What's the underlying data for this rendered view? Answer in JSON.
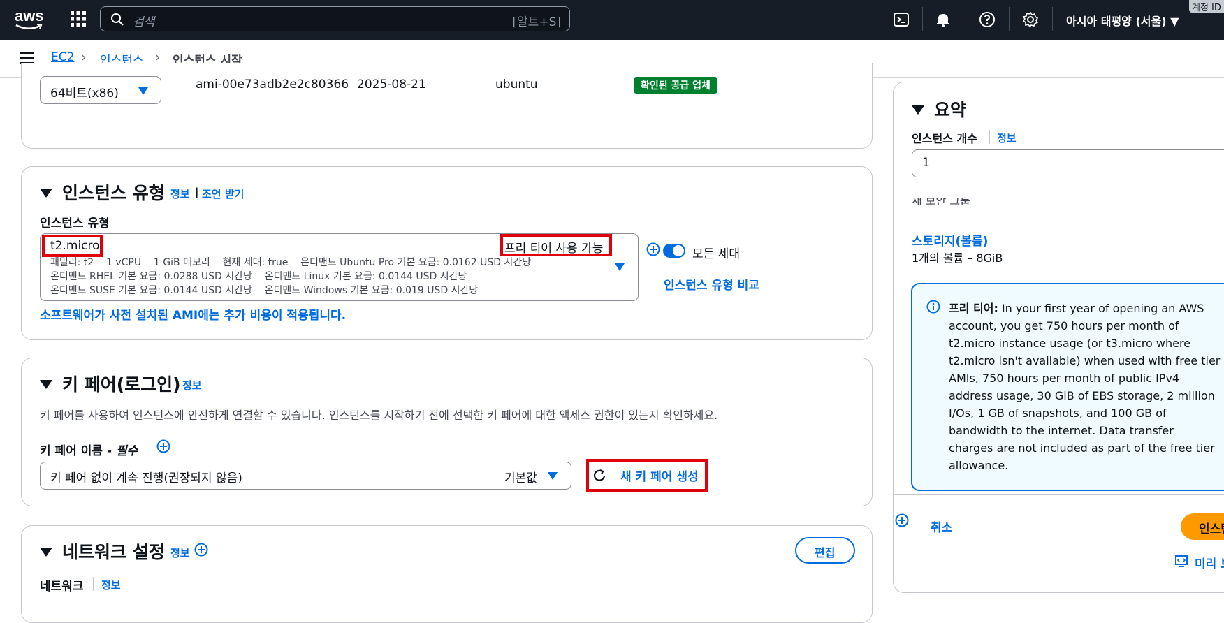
{
  "topbar": {
    "logo_text": "aws",
    "search_placeholder": "검색",
    "search_shortcut": "[알트+S]",
    "region": "아시아 태평양 (서울) ▼",
    "account_badge": "계정 ID"
  },
  "breadcrumb": {
    "items": [
      "EC2",
      "인스턴스"
    ],
    "current": "인스턴스 시작"
  },
  "ami": {
    "arch": "64비트(x86)",
    "ami_id": "ami-00e73adb2e2c80366",
    "date": "2025-08-21",
    "user": "ubuntu",
    "badge": "확인된 공급 업체"
  },
  "instance_type": {
    "title": "인스턴스 유형",
    "info": "정보",
    "sep": "|",
    "advice": "조언 받기",
    "field_label": "인스턴스 유형",
    "selected": "t2.micro",
    "free_tier_tag": "프리 티어 사용 가능",
    "detail_line1": "패밀리: t2    1 vCPU    1 GiB 메모리    현재 세대: true    온디맨드 Ubuntu Pro 기본 요금: 0.0162 USD 시간당",
    "detail_line2": "온디맨드 RHEL 기본 요금: 0.0288 USD 시간당    온디맨드 Linux 기본 요금: 0.0144 USD 시간당",
    "detail_line3": "온디맨드 SUSE 기본 요금: 0.0144 USD 시간당    온디맨드 Windows 기본 요금: 0.019 USD 시간당",
    "all_gen_label": "모든 세대",
    "compare_link": "인스턴스 유형 비교",
    "ami_note": "소프트웨어가 사전 설치된 AMI에는 추가 비용이 적용됩니다."
  },
  "key_pair": {
    "title": "키 페어(로그인)",
    "info": "정보",
    "description": "키 페어를 사용하여 인스턴스에 안전하게 연결할 수 있습니다. 인스턴스를 시작하기 전에 선택한 키 페어에 대한 액세스 권한이 있는지 확인하세요.",
    "field_label": "키 페어 이름 - ",
    "required": "필수",
    "selected": "키 페어 없이 계속 진행(권장되지 않음)",
    "default_tag": "기본값",
    "create_new": "새 키 페어 생성"
  },
  "network": {
    "title": "네트워크 설정",
    "info": "정보",
    "edit_button": "편집",
    "field_label": "네트워크",
    "field_info": "정보"
  },
  "summary": {
    "title": "요약",
    "instance_count_label": "인스턴스 개수",
    "instance_count_info": "정보",
    "instance_count_value": "1",
    "cut_text": "새 보안 그룹",
    "storage_label": "스토리지(볼륨)",
    "storage_value": "1개의 볼륨 – 8GiB",
    "free_tier_title": "프리 티어:",
    "free_tier_lines": [
      " In your first year of opening an AWS",
      "account, you get 750 hours per month of",
      "t2.micro instance usage (or t3.micro where",
      "t2.micro isn't available) when used with free tier",
      "AMIs, 750 hours per month of public IPv4",
      "address usage, 30 GiB of EBS storage, 2 million",
      "I/Os, 1 GB of snapshots, and 100 GB of",
      "bandwidth to the internet. Data transfer",
      "charges are not included as part of the free tier",
      "allowance."
    ],
    "cancel": "취소",
    "launch": "인스턴스 시작",
    "preview": "미리 보기 코드"
  },
  "colors": {
    "topbar_bg": "#161d26",
    "link_blue": "#006ce0",
    "badge_green": "#00802f",
    "highlight_red": "#e0000c",
    "launch_orange": "#ff9900"
  }
}
